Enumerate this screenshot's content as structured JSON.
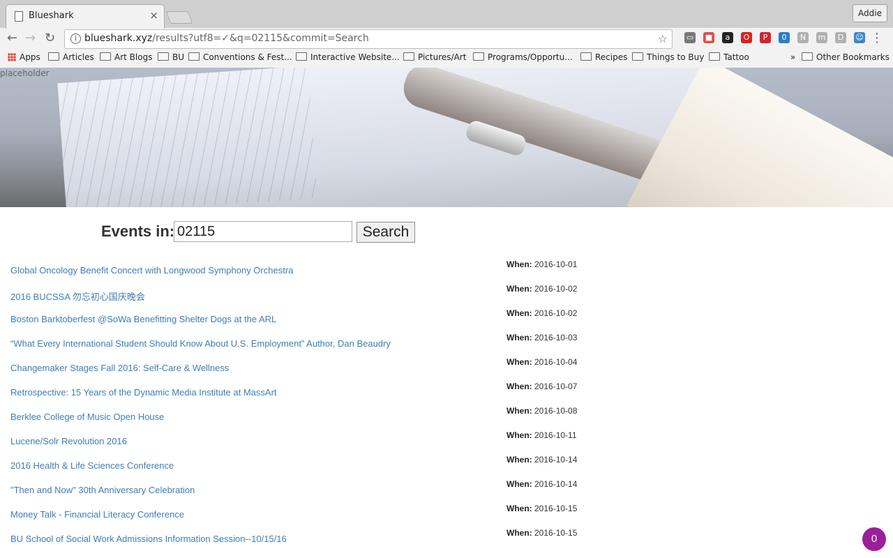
{
  "browser": {
    "tab_title": "Blueshark",
    "tab_close_glyph": "×",
    "profile_name": "Addie",
    "back_glyph": "←",
    "forward_glyph": "→",
    "reload_glyph": "↻",
    "info_glyph": "i",
    "url_host": "blueshark.xyz",
    "url_path": "/results?utf8=✓&q=02115&commit=Search",
    "star_glyph": "☆",
    "menu_glyph": "⋮",
    "extensions": [
      {
        "name": "cast-icon",
        "glyph": "▭",
        "color": "#777777"
      },
      {
        "name": "reader-icon",
        "glyph": "■",
        "color": "#d9534f"
      },
      {
        "name": "amazon-icon",
        "glyph": "a",
        "color": "#222222"
      },
      {
        "name": "opera-icon",
        "glyph": "O",
        "color": "#e02020"
      },
      {
        "name": "pinterest-icon",
        "glyph": "P",
        "color": "#d6242d"
      },
      {
        "name": "badge-extension-icon",
        "glyph": "0",
        "color": "#2a7dc8"
      },
      {
        "name": "nx-icon",
        "glyph": "N",
        "color": "#b0b0b0"
      },
      {
        "name": "m-icon",
        "glyph": "m",
        "color": "#b0b0b0"
      },
      {
        "name": "dev-icon",
        "glyph": "D",
        "color": "#b0b0b0"
      },
      {
        "name": "face-icon",
        "glyph": "☺",
        "color": "#3f88c5"
      }
    ],
    "bookmarks": [
      {
        "label": "Apps",
        "type": "apps"
      },
      {
        "label": "Articles",
        "type": "folder"
      },
      {
        "label": "Art Blogs",
        "type": "folder"
      },
      {
        "label": "BU",
        "type": "folder"
      },
      {
        "label": "Conventions & Fest...",
        "type": "folder"
      },
      {
        "label": "Interactive Website...",
        "type": "folder"
      },
      {
        "label": "Pictures/Art",
        "type": "folder"
      },
      {
        "label": "Programs/Opportu...",
        "type": "folder"
      },
      {
        "label": "Recipes",
        "type": "folder"
      },
      {
        "label": "Things to Buy",
        "type": "folder"
      },
      {
        "label": "Tattoo",
        "type": "folder"
      }
    ],
    "bookmarks_overflow": "»",
    "other_bookmarks": "Other Bookmarks"
  },
  "hero": {
    "placeholder_text": "placeholder"
  },
  "search": {
    "label": "Events in:",
    "value": "02115",
    "button_label": "Search"
  },
  "events": [
    {
      "title": "Global Oncology Benefit Concert with Longwood Symphony Orchestra",
      "when_label": "When:",
      "when": "2016-10-01"
    },
    {
      "title": "2016 BUCSSA 勿忘初心国庆晚会",
      "when_label": "When:",
      "when": "2016-10-02"
    },
    {
      "title": "Boston Barktoberfest @SoWa Benefitting Shelter Dogs at the ARL",
      "when_label": "When:",
      "when": "2016-10-02"
    },
    {
      "title": "“What Every International Student Should Know About U.S. Employment” Author, Dan Beaudry",
      "when_label": "When:",
      "when": "2016-10-03"
    },
    {
      "title": "Changemaker Stages Fall 2016: Self-Care & Wellness",
      "when_label": "When:",
      "when": "2016-10-04"
    },
    {
      "title": "Retrospective: 15 Years of the Dynamic Media Institute at MassArt",
      "when_label": "When:",
      "when": "2016-10-07"
    },
    {
      "title": "Berklee College of Music Open House",
      "when_label": "When:",
      "when": "2016-10-08"
    },
    {
      "title": "Lucene/Solr Revolution 2016",
      "when_label": "When:",
      "when": "2016-10-11"
    },
    {
      "title": "2016 Health & Life Sciences Conference",
      "when_label": "When:",
      "when": "2016-10-14"
    },
    {
      "title": "\"Then and Now\" 30th Anniversary Celebration",
      "when_label": "When:",
      "when": "2016-10-14"
    },
    {
      "title": "Money Talk - Financial Literacy Conference",
      "when_label": "When:",
      "when": "2016-10-15"
    },
    {
      "title": "BU School of Social Work Admissions Information Session--10/15/16",
      "when_label": "When:",
      "when": "2016-10-15"
    }
  ],
  "chat_badge": {
    "count": "0",
    "color": "#9b1f9a"
  }
}
